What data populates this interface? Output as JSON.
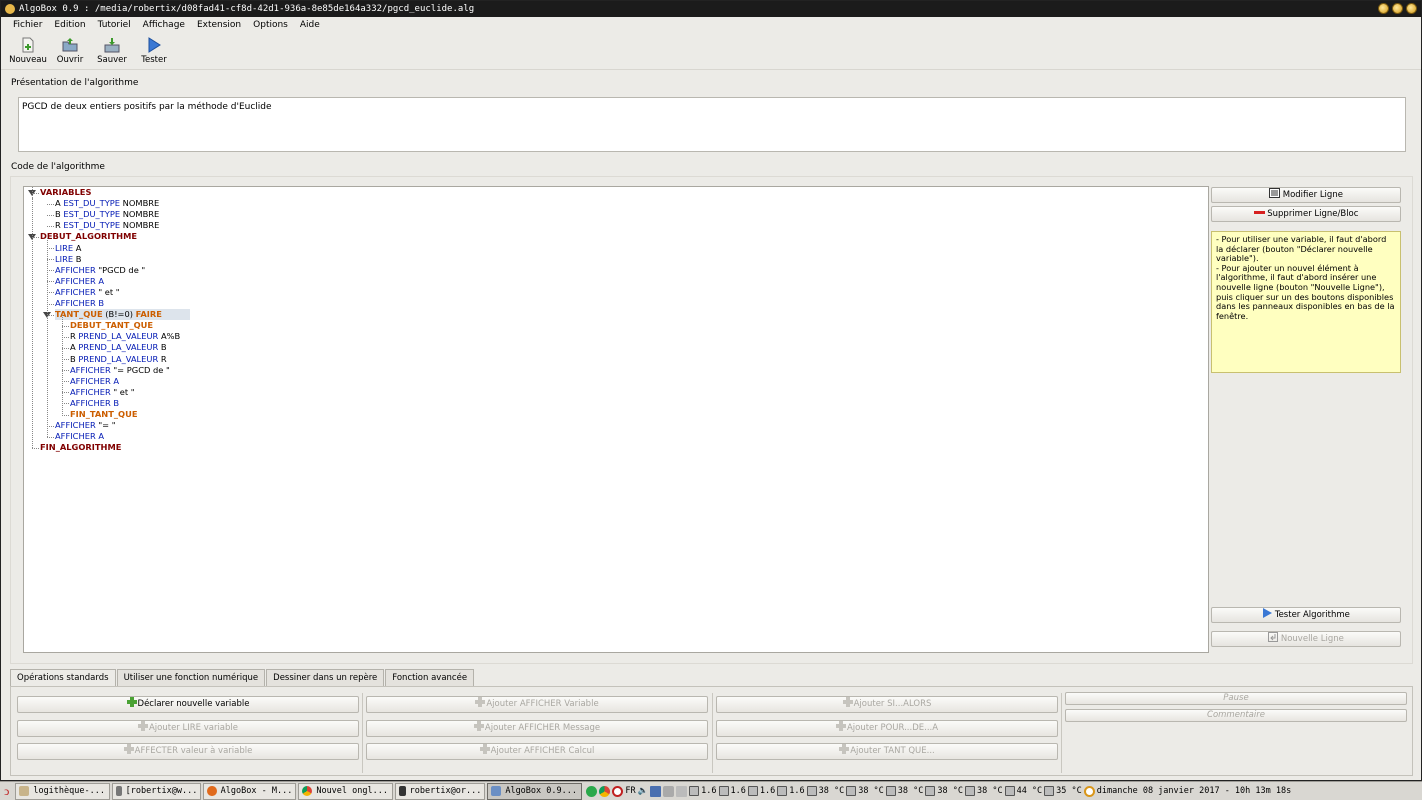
{
  "window": {
    "title": "AlgoBox 0.9 : /media/robertix/d08fad41-cf8d-42d1-936a-8e85de164a332/pgcd_euclide.alg"
  },
  "menu": [
    "Fichier",
    "Edition",
    "Tutoriel",
    "Affichage",
    "Extension",
    "Options",
    "Aide"
  ],
  "toolbar": {
    "new": "Nouveau",
    "open": "Ouvrir",
    "save": "Sauver",
    "test": "Tester"
  },
  "presentation": {
    "label": "Présentation de l'algorithme",
    "text": "PGCD de deux entiers positifs par la méthode d'Euclide"
  },
  "code": {
    "label": "Code de l'algorithme",
    "lines": [
      {
        "parts": [
          [
            "red",
            "VARIABLES"
          ]
        ]
      },
      {
        "parts": [
          [
            "black",
            "A "
          ],
          [
            "blue",
            "EST_DU_TYPE"
          ],
          [
            "black",
            " NOMBRE"
          ]
        ]
      },
      {
        "parts": [
          [
            "black",
            "B "
          ],
          [
            "blue",
            "EST_DU_TYPE"
          ],
          [
            "black",
            " NOMBRE"
          ]
        ]
      },
      {
        "parts": [
          [
            "black",
            "R "
          ],
          [
            "blue",
            "EST_DU_TYPE"
          ],
          [
            "black",
            " NOMBRE"
          ]
        ]
      },
      {
        "parts": [
          [
            "red",
            "DEBUT_ALGORITHME"
          ]
        ]
      },
      {
        "parts": [
          [
            "blue",
            "LIRE"
          ],
          [
            "black",
            " A"
          ]
        ]
      },
      {
        "parts": [
          [
            "blue",
            "LIRE"
          ],
          [
            "black",
            " B"
          ]
        ]
      },
      {
        "parts": [
          [
            "blue",
            "AFFICHER"
          ],
          [
            "black",
            " \"PGCD de \""
          ]
        ]
      },
      {
        "parts": [
          [
            "blue",
            "AFFICHER"
          ],
          [
            "black",
            " "
          ],
          [
            "blue",
            "A"
          ]
        ]
      },
      {
        "parts": [
          [
            "blue",
            "AFFICHER"
          ],
          [
            "black",
            " \" et \""
          ]
        ]
      },
      {
        "parts": [
          [
            "blue",
            "AFFICHER"
          ],
          [
            "black",
            " "
          ],
          [
            "blue",
            "B"
          ]
        ]
      },
      {
        "parts": [
          [
            "orange",
            "TANT_QUE"
          ],
          [
            "black",
            " (B!=0) "
          ],
          [
            "orange",
            "FAIRE"
          ]
        ]
      },
      {
        "parts": [
          [
            "orange",
            "DEBUT_TANT_QUE"
          ]
        ]
      },
      {
        "parts": [
          [
            "black",
            "R "
          ],
          [
            "blue",
            "PREND_LA_VALEUR"
          ],
          [
            "black",
            " A%B"
          ]
        ]
      },
      {
        "parts": [
          [
            "black",
            "A "
          ],
          [
            "blue",
            "PREND_LA_VALEUR"
          ],
          [
            "black",
            " B"
          ]
        ]
      },
      {
        "parts": [
          [
            "black",
            "B "
          ],
          [
            "blue",
            "PREND_LA_VALEUR"
          ],
          [
            "black",
            " R"
          ]
        ]
      },
      {
        "parts": [
          [
            "blue",
            "AFFICHER"
          ],
          [
            "black",
            " \"= PGCD de \""
          ]
        ]
      },
      {
        "parts": [
          [
            "blue",
            "AFFICHER"
          ],
          [
            "black",
            " "
          ],
          [
            "blue",
            "A"
          ]
        ]
      },
      {
        "parts": [
          [
            "blue",
            "AFFICHER"
          ],
          [
            "black",
            " \" et \""
          ]
        ]
      },
      {
        "parts": [
          [
            "blue",
            "AFFICHER"
          ],
          [
            "black",
            " "
          ],
          [
            "blue",
            "B"
          ]
        ]
      },
      {
        "parts": [
          [
            "orange",
            "FIN_TANT_QUE"
          ]
        ]
      },
      {
        "parts": [
          [
            "blue",
            "AFFICHER"
          ],
          [
            "black",
            " \"= \""
          ]
        ]
      },
      {
        "parts": [
          [
            "blue",
            "AFFICHER"
          ],
          [
            "black",
            " "
          ],
          [
            "blue",
            "A"
          ]
        ]
      },
      {
        "parts": [
          [
            "red",
            "FIN_ALGORITHME"
          ]
        ]
      }
    ]
  },
  "side": {
    "modify": "Modifier Ligne",
    "delete": "Supprimer Ligne/Bloc",
    "help": "- Pour utiliser une variable, il faut d'abord la déclarer (bouton \"Déclarer nouvelle variable\").\n- Pour ajouter un nouvel élément à l'algorithme, il faut d'abord insérer une nouvelle ligne (bouton \"Nouvelle Ligne\"), puis cliquer sur un des boutons disponibles dans les panneaux disponibles en bas de la fenêtre.",
    "test_algo": "Tester Algorithme",
    "new_line": "Nouvelle Ligne"
  },
  "tabs": [
    "Opérations standards",
    "Utiliser une fonction numérique",
    "Dessiner dans un repère",
    "Fonction avancée"
  ],
  "ops": {
    "declare": "Déclarer nouvelle variable",
    "read": "Ajouter LIRE variable",
    "assign": "AFFECTER valeur à variable",
    "show_var": "Ajouter AFFICHER Variable",
    "show_msg": "Ajouter AFFICHER Message",
    "show_calc": "Ajouter AFFICHER Calcul",
    "if": "Ajouter SI...ALORS",
    "for": "Ajouter POUR...DE...A",
    "while": "Ajouter TANT QUE...",
    "pause": "Pause",
    "comment": "Commentaire"
  },
  "taskbar": {
    "tasks": [
      "logithèque-...",
      "[robertix@w...",
      "AlgoBox - M...",
      "Nouvel ongl...",
      "robertix@or...",
      "AlgoBox 0.9..."
    ],
    "lang": "FR",
    "cpu": [
      "1.6",
      "1.6",
      "1.6",
      "1.6"
    ],
    "temps": [
      "38 °C",
      "38 °C",
      "38 °C",
      "38 °C",
      "38 °C",
      "44 °C",
      "35 °C"
    ],
    "clock": "dimanche 08 janvier 2017 - 10h 13m 18s"
  },
  "colors": {
    "red": "#800000",
    "blue": "#0018b4",
    "orange": "#cc5e00"
  }
}
